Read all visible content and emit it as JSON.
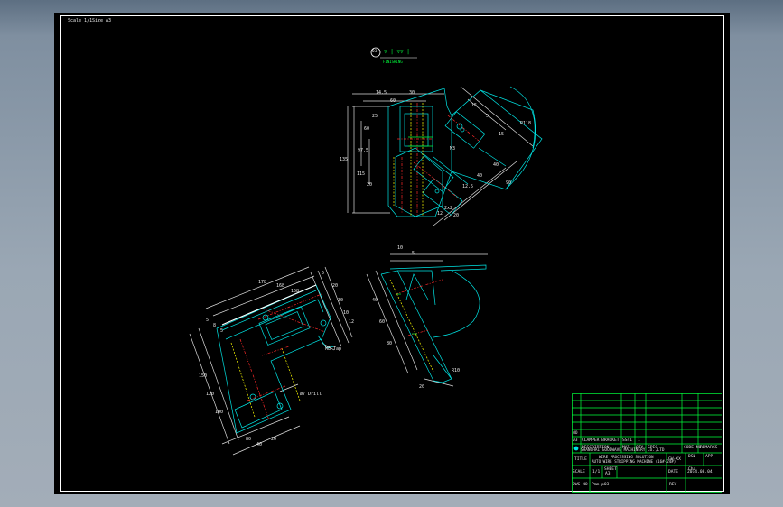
{
  "sheet": {
    "scale_label": "Scale 1/1",
    "size_label": "Size A3"
  },
  "finish_note": {
    "circle_number": "03",
    "symbols": "▽ | ▽▽ |",
    "label": "FINISHING"
  },
  "dimensions": {
    "top_view": [
      "14.5",
      "30",
      "60",
      "135",
      "115",
      "60",
      "25",
      "97.5",
      "20",
      "R118",
      "15",
      "5",
      "15",
      "M3",
      "12.5",
      "40",
      "40",
      "90",
      "12",
      "2x2",
      "20"
    ],
    "front_view": [
      "178",
      "168",
      "158",
      "5",
      "20",
      "30",
      "10",
      "12",
      "5",
      "8",
      "5",
      "M8 Tap",
      "ø7 Drill",
      "150",
      "120",
      "100",
      "80",
      "40",
      "20"
    ],
    "side_view": [
      "10",
      "5",
      "40",
      "60",
      "80",
      "20",
      "R10"
    ]
  },
  "title_block": {
    "header_row": {
      "no": "03",
      "description": "CLAMPER BRACKET",
      "mat": "SS41",
      "qty": "1"
    },
    "column_headers": {
      "no": "NO",
      "description": "DESCRIPTION",
      "mat": "MAT",
      "qty": "QTY",
      "spec": "SPEC",
      "code_no": "CODE NO",
      "remarks": "REMARKS"
    },
    "company": "SHANGHAI GOODWAVE MACHINERY CO.,LTD",
    "title_label": "TITLE",
    "title_line1": "WIRE PROCESSING SOLUTION",
    "title_line2": "AUTO WIRE STRIPPING MACHINE (16#-24#)",
    "title_code": "GW-XX",
    "dsn_label": "DSN",
    "chk_label": "Chk",
    "app_label": "APP",
    "scale_label": "SCALE",
    "scale_value": "1/1",
    "sheet_label": "SHEET",
    "sheet_value": "A3",
    "date_label": "DATE",
    "date_value": "2014.08.04",
    "dwg_label": "DWG NO",
    "dwg_value": "Pmm-p03",
    "rev_label": "REV"
  },
  "colors": {
    "background": "#000000",
    "outline": "#00e5e5",
    "centerline": "#ff2a2a",
    "hidden": "#ffff00",
    "titleblock": "#00ff3c",
    "dimension": "#ffffff"
  }
}
